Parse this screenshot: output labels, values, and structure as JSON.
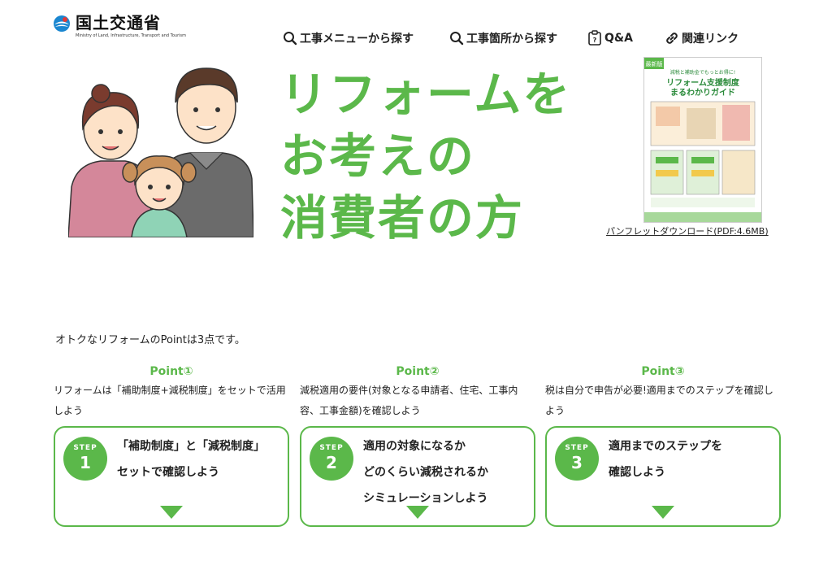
{
  "colors": {
    "accent": "#5bb84a",
    "text": "#222222",
    "background": "#ffffff"
  },
  "header": {
    "logo_ja": "国土交通省",
    "logo_en": "Ministry of Land, Infrastructure, Transport and Tourism",
    "nav": [
      {
        "label": "工事メニューから探す",
        "icon": "search-icon"
      },
      {
        "label": "工事箇所から探す",
        "icon": "search-icon"
      },
      {
        "label": "Q&A",
        "icon": "qa-icon"
      },
      {
        "label": "関連リンク",
        "icon": "link-icon"
      }
    ]
  },
  "hero": {
    "title_lines": [
      "リフォームを",
      "お考えの",
      "消費者の方"
    ]
  },
  "pamphlet": {
    "cover_tag": "最新版",
    "cover_subtitle": "減税と補助金でもっとお得に!",
    "cover_title_1": "リフォーム支援制度",
    "cover_title_2": "まるわかりガイド",
    "download_label": "パンフレットダウンロード(PDF:4.6MB)"
  },
  "intro": "オトクなリフォームのPointは3点です。",
  "points": [
    {
      "heading": "Point①",
      "desc": "リフォームは「補助制度+減税制度」をセットで活用しよう",
      "step_label": "STEP",
      "step_num": "1",
      "lines": [
        "「補助制度」と「減税制度」",
        "セットで確認しよう"
      ]
    },
    {
      "heading": "Point②",
      "desc": "減税適用の要件(対象となる申請者、住宅、工事内容、工事金額)を確認しよう",
      "step_label": "STEP",
      "step_num": "2",
      "lines": [
        "適用の対象になるか",
        "どのくらい減税されるか",
        "シミュレーションしよう"
      ]
    },
    {
      "heading": "Point③",
      "desc": "税は自分で申告が必要!適用までのステップを確認しよう",
      "step_label": "STEP",
      "step_num": "3",
      "lines": [
        "適用までのステップを",
        "確認しよう"
      ]
    }
  ]
}
